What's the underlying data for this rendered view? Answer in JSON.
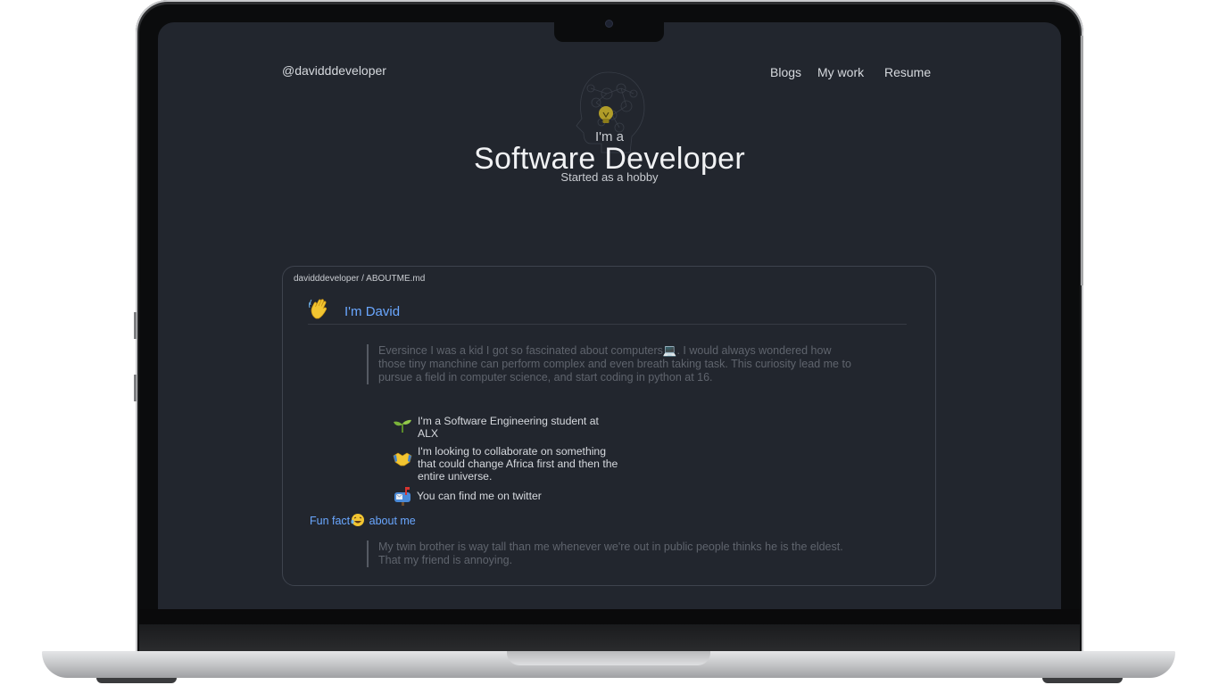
{
  "site": {
    "handle": "@davidddeveloper",
    "nav": {
      "blogs": "Blogs",
      "my_work": "My work",
      "resume": "Resume"
    }
  },
  "hero": {
    "intro": "I'm a",
    "title": "Software Developer",
    "subtitle": "Started as a hobby"
  },
  "readme": {
    "path": "davidddeveloper / ABOUTME.md",
    "heading": "I'm David",
    "quote": "Eversince I was a kid I got so fascinated about computers💻. I would always wondered how those tiny manchine can perform complex and even breath taking task. This curiosity lead me to pursue a field in computer science, and start coding in python at 16.",
    "items": [
      {
        "icon": "seedling-icon",
        "text": "I'm a Software Engineering student at ALX"
      },
      {
        "icon": "handshake-icon",
        "text": "I'm looking to collaborate on something that could change Africa first and then the entire universe."
      },
      {
        "icon": "mailbox-icon",
        "text": "You can find me on twitter"
      }
    ],
    "fun_fact_before": "Fun fact",
    "fun_fact_after": " about me",
    "fun_fact_quote": "My twin brother is way tall than me whenever we're out in public people thinks he is the eldest. That my friend is annoying."
  },
  "colors": {
    "background": "#22262e",
    "accent": "#6aa7ff",
    "text": "#d6d9de",
    "muted": "#5f646d"
  }
}
